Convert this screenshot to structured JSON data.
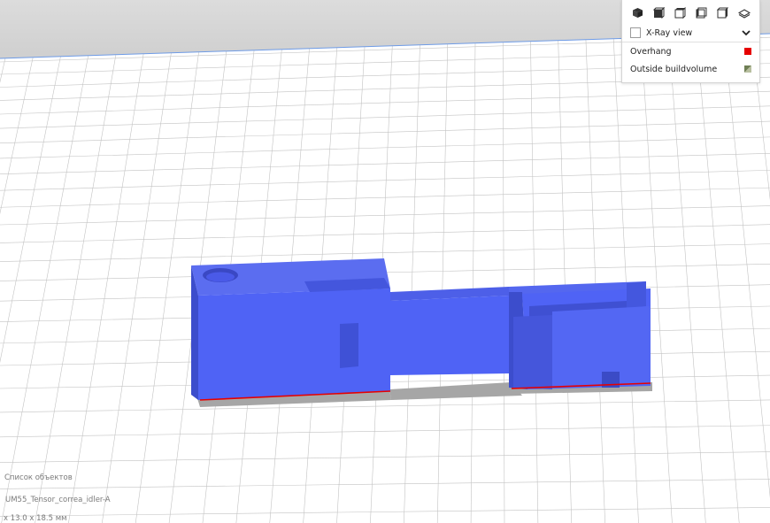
{
  "view_panel": {
    "camera_views": [
      {
        "name": "3d-view"
      },
      {
        "name": "front-view"
      },
      {
        "name": "top-view"
      },
      {
        "name": "left-view"
      },
      {
        "name": "right-view"
      },
      {
        "name": "layflat-view"
      }
    ],
    "xray_label": "X-Ray view",
    "xray_checked": false,
    "legend": [
      {
        "label": "Overhang",
        "color": "#e60000"
      },
      {
        "label": "Outside buildvolume",
        "color": "#8f9a6a"
      }
    ]
  },
  "object_list": {
    "title": "Список объектов",
    "object_name": "UM55_Tensor_correa_idler-A",
    "dimensions": "x 13.0 x 18.5 мм"
  },
  "colors": {
    "model": "#4f63f5",
    "model_dark": "#3b4cc9",
    "shadow": "#a8a8a8",
    "build_plate": "#ffffff",
    "grid": "#bdbdbd"
  }
}
